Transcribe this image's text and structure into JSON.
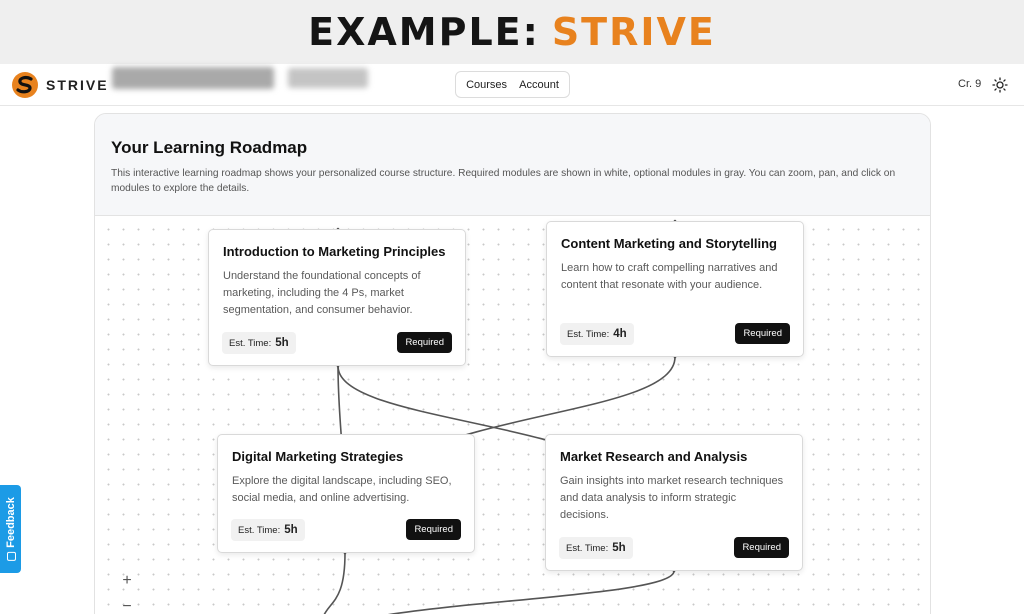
{
  "banner": {
    "prefix": "EXAMPLE:",
    "brand": "STRIVE"
  },
  "navbar": {
    "logo_text": "STRIVE",
    "menu": [
      {
        "label": "Courses"
      },
      {
        "label": "Account"
      }
    ],
    "credits": "Cr. 9",
    "theme_icon": "sun-icon"
  },
  "roadmap": {
    "title": "Your Learning Roadmap",
    "description": "This interactive learning roadmap shows your personalized course structure. Required modules are shown in white, optional modules in gray. You can zoom, pan, and click on modules to explore the details.",
    "zoom_in": "+",
    "zoom_out": "−",
    "est_label": "Est. Time:",
    "modules": [
      {
        "title": "Introduction to Marketing Principles",
        "description": "Understand the foundational concepts of marketing, including the 4 Ps, market segmentation, and consumer behavior.",
        "time": "5h",
        "status": "Required"
      },
      {
        "title": "Content Marketing and Storytelling",
        "description": "Learn how to craft compelling narratives and content that resonate with your audience.",
        "time": "4h",
        "status": "Required"
      },
      {
        "title": "Digital Marketing Strategies",
        "description": "Explore the digital landscape, including SEO, social media, and online advertising.",
        "time": "5h",
        "status": "Required"
      },
      {
        "title": "Market Research and Analysis",
        "description": "Gain insights into market research techniques and data analysis to inform strategic decisions.",
        "time": "5h",
        "status": "Required"
      }
    ]
  },
  "feedback": {
    "label": "Feedback"
  },
  "colors": {
    "accent": "#e8821e",
    "feedback": "#1c9be6",
    "required_badge": "#111111"
  }
}
